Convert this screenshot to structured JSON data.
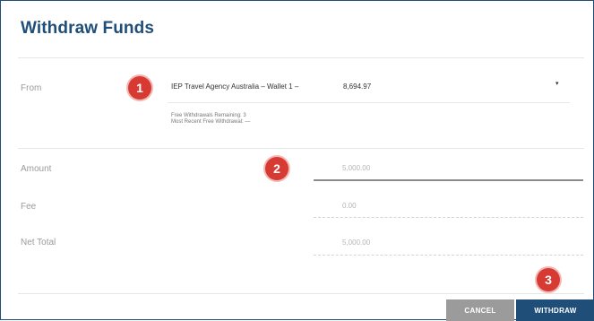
{
  "dialog": {
    "title": "Withdraw Funds"
  },
  "from": {
    "label": "From",
    "account": "IEP Travel Agency Australia – Wallet 1 –",
    "balance": "8,694.97",
    "caret": "▾",
    "free_withdrawals_remaining": "Free Withdrawals Remaining: 3",
    "most_recent_free_withdrawal": "Most Recent Free Withdrawal: —"
  },
  "amount": {
    "label": "Amount",
    "value": "5,000.00"
  },
  "fee": {
    "label": "Fee",
    "value": "0.00"
  },
  "net_total": {
    "label": "Net Total",
    "value": "5,000.00"
  },
  "callouts": {
    "one": "1",
    "two": "2",
    "three": "3"
  },
  "actions": {
    "cancel_label": "CANCEL",
    "withdraw_label": "WITHDRAW"
  },
  "colors": {
    "brand": "#1f4e79",
    "callout": "#d63a32",
    "cancel": "#9b9b9b"
  }
}
